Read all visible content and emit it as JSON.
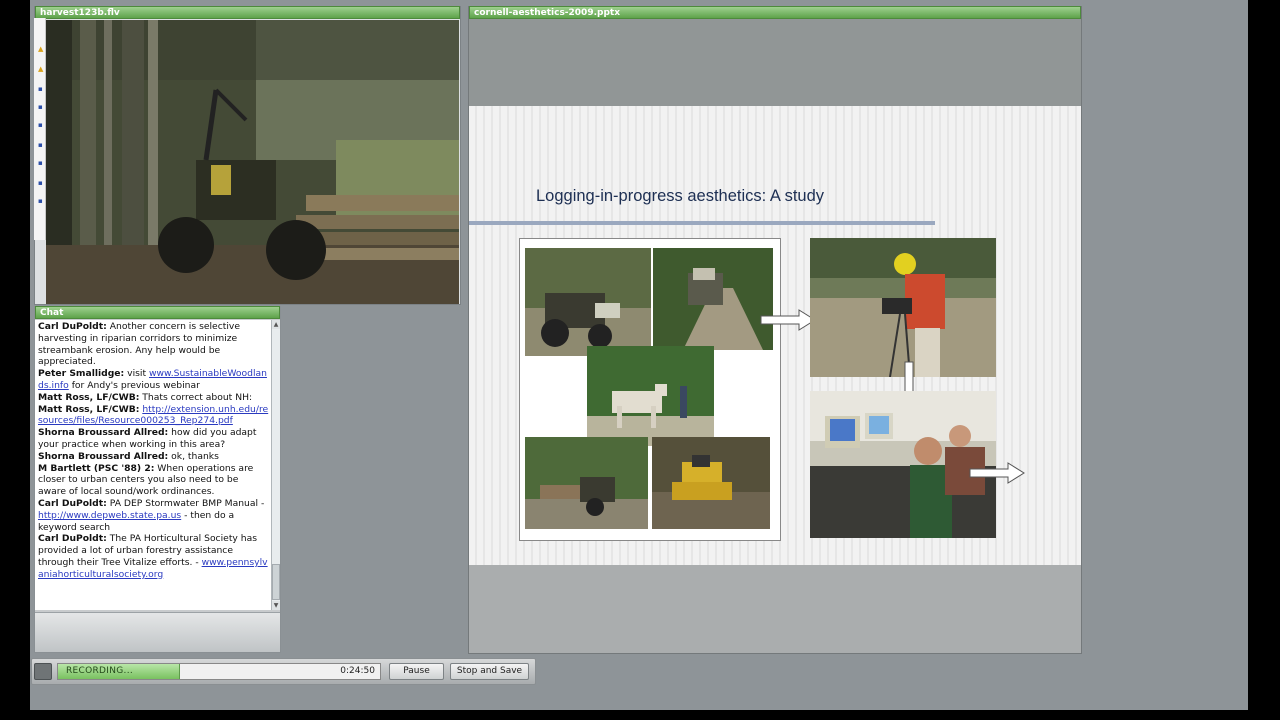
{
  "video_pod": {
    "title": "harvest123b.flv"
  },
  "presentation_pod": {
    "title": "cornell-aesthetics-2009.pptx",
    "slide": {
      "title": "Logging-in-progress aesthetics: A study"
    }
  },
  "chat_pod": {
    "title": "Chat",
    "messages": [
      {
        "sender": "Carl DuPoldt:",
        "text": " Another concern is selective harvesting in riparian corridors to minimize streambank erosion.  Any help would be appreciated.",
        "link": "",
        "after": ""
      },
      {
        "sender": "Peter Smallidge:",
        "text": " visit ",
        "link": "www.SustainableWoodlands.info",
        "after": " for Andy's previous webinar"
      },
      {
        "sender": "Matt Ross, LF/CWB:",
        "text": " Thats correct about NH:",
        "link": "",
        "after": ""
      },
      {
        "sender": "Matt Ross, LF/CWB:",
        "text": " ",
        "link": "http://extension.unh.edu/resources/files/Resource000253_Rep274.pdf",
        "after": ""
      },
      {
        "sender": "Shorna Broussard Allred:",
        "text": " how did you adapt your practice when working in this area?",
        "link": "",
        "after": ""
      },
      {
        "sender": "Shorna Broussard Allred:",
        "text": " ok, thanks",
        "link": "",
        "after": ""
      },
      {
        "sender": "M Bartlett (PSC '88) 2:",
        "text": " When operations are closer to urban centers you also need to be aware of local sound/work ordinances.",
        "link": "",
        "after": ""
      },
      {
        "sender": "Carl DuPoldt:",
        "text": " PA DEP Stormwater BMP Manual - ",
        "link": "http://www.depweb.state.pa.us",
        "after": " - then do a keyword search"
      },
      {
        "sender": "Carl DuPoldt:",
        "text": " The PA Horticultural Society has provided a lot of urban forestry assistance through their Tree Vitalize efforts. - ",
        "link": "www.pennsylvaniahorticulturalsociety.org",
        "after": ""
      }
    ]
  },
  "recording": {
    "status": "RECORDING...",
    "elapsed": "0:24:50",
    "progress_fraction": 0.38,
    "pause_label": "Pause",
    "stop_label": "Stop and Save"
  },
  "colors": {
    "pod_title_bar": "#5ea34b",
    "slide_title": "#1d2f53",
    "link": "#2a3ac0"
  }
}
